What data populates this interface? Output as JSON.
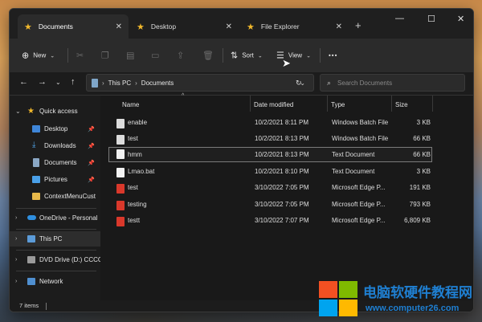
{
  "tabs": [
    {
      "label": "Documents",
      "icon": "star-icon",
      "active": true
    },
    {
      "label": "Desktop",
      "icon": "star-icon",
      "active": false
    },
    {
      "label": "File Explorer",
      "icon": "star-icon",
      "active": false
    }
  ],
  "toolbar": {
    "new_label": "New",
    "sort_label": "Sort",
    "view_label": "View",
    "more_label": "•••"
  },
  "address": {
    "crumbs": [
      "This PC",
      "Documents"
    ],
    "search_placeholder": "Search Documents"
  },
  "nav": {
    "quick_access": "Quick access",
    "items": [
      "Desktop",
      "Downloads",
      "Documents",
      "Pictures",
      "ContextMenuCust"
    ],
    "onedrive": "OneDrive - Personal",
    "thispc": "This PC",
    "dvd": "DVD Drive (D:) CCCC",
    "network": "Network"
  },
  "columns": {
    "name": "Name",
    "date": "Date modified",
    "type": "Type",
    "size": "Size"
  },
  "files": [
    {
      "name": "enable",
      "date": "10/2/2021 8:11 PM",
      "type": "Windows Batch File",
      "size": "3 KB",
      "kind": "bat"
    },
    {
      "name": "test",
      "date": "10/2/2021 8:13 PM",
      "type": "Windows Batch File",
      "size": "66 KB",
      "kind": "bat"
    },
    {
      "name": "hmm",
      "date": "10/2/2021 8:13 PM",
      "type": "Text Document",
      "size": "66 KB",
      "kind": "txt"
    },
    {
      "name": "Lmao.bat",
      "date": "10/2/2021 8:10 PM",
      "type": "Text Document",
      "size": "3 KB",
      "kind": "txt"
    },
    {
      "name": "test",
      "date": "3/10/2022 7:05 PM",
      "type": "Microsoft Edge P...",
      "size": "191 KB",
      "kind": "pdf"
    },
    {
      "name": "testing",
      "date": "3/10/2022 7:05 PM",
      "type": "Microsoft Edge P...",
      "size": "793 KB",
      "kind": "pdf"
    },
    {
      "name": "testt",
      "date": "3/10/2022 7:07 PM",
      "type": "Microsoft Edge P...",
      "size": "6,809 KB",
      "kind": "pdf"
    }
  ],
  "status": {
    "count": "7 items"
  },
  "watermark": {
    "title": "电脑软硬件教程网",
    "url": "www.computer26.com"
  },
  "colors": {
    "accent": "#f2b92c",
    "pdf": "#d9382b",
    "watermark": "#1f7fd1"
  }
}
